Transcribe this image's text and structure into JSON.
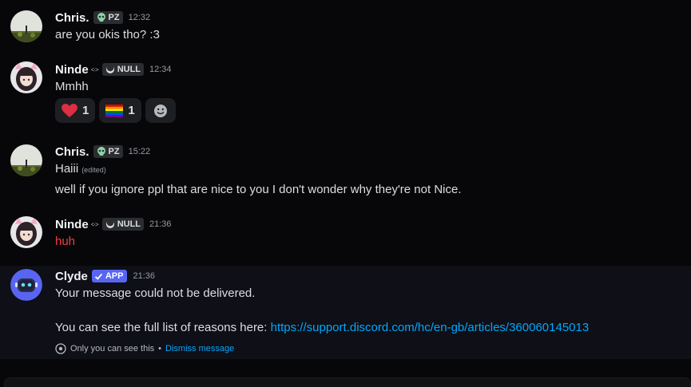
{
  "messages": [
    {
      "author": "Chris.",
      "tag": "PZ",
      "tag_icon": "skull-icon",
      "time": "12:32",
      "lines": [
        "are you okis tho? :3"
      ]
    },
    {
      "author": "Ninde",
      "decoration": "<·>",
      "tag": "NULL",
      "tag_icon": "moon-icon",
      "time": "12:34",
      "lines": [
        "Mmhh"
      ],
      "reactions": [
        {
          "emoji": "heart-icon",
          "count": "1"
        },
        {
          "emoji": "pride-flag-icon",
          "count": "1"
        }
      ],
      "add_reaction_icon": "add-reaction-icon"
    },
    {
      "author": "Chris.",
      "tag": "PZ",
      "tag_icon": "skull-icon",
      "time": "15:22",
      "lines": [
        "Haiii",
        "well if you ignore ppl that are nice to you I don't wonder why they're not Nice."
      ],
      "edited_label": "(edited)"
    },
    {
      "author": "Ninde",
      "decoration": "<·>",
      "tag": "NULL",
      "tag_icon": "moon-icon",
      "time": "21:36",
      "lines": [
        "huh"
      ],
      "text_color": "#f23f43"
    },
    {
      "author": "Clyde",
      "tag": "APP",
      "tag_icon": "checkmark-icon",
      "time": "21:36",
      "lines": [
        "Your message could not be delivered.",
        "You can see the full list of reasons here: "
      ],
      "link": "https://support.discord.com/hc/en-gb/articles/360060145013",
      "ephemeral_note": "Only you can see this",
      "separator": " • ",
      "dismiss_label": "Dismiss message",
      "highlight_bg": "#0e0f17"
    }
  ],
  "colors": {
    "background": "#070709",
    "link": "#00a8fc",
    "app_badge": "#5865f2",
    "error_text": "#f23f43"
  }
}
